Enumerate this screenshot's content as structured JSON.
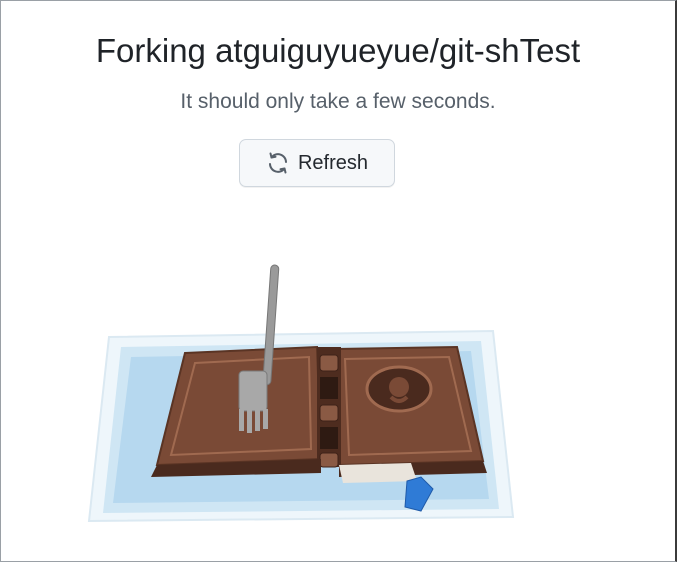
{
  "page": {
    "title": "Forking atguiguyueyue/git-shTest",
    "subtitle": "It should only take a few seconds.",
    "refresh_button": {
      "label": "Refresh",
      "icon": "sync-icon"
    },
    "illustration": {
      "description_icon": "fork-book-illustration"
    }
  }
}
